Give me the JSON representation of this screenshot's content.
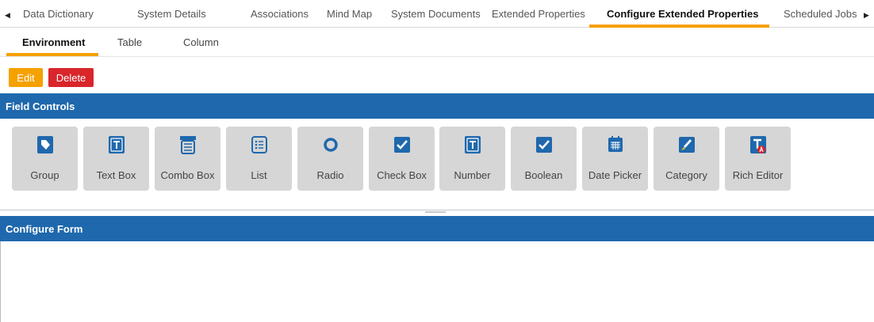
{
  "top_tabs": [
    {
      "label": "Data Dictionary",
      "active": false
    },
    {
      "label": "System Details",
      "active": false
    },
    {
      "label": "Associations",
      "active": false
    },
    {
      "label": "Mind Map",
      "active": false
    },
    {
      "label": "System Documents",
      "active": false
    },
    {
      "label": "Extended Properties",
      "active": false
    },
    {
      "label": "Configure Extended Properties",
      "active": true
    },
    {
      "label": "Scheduled Jobs",
      "active": false
    }
  ],
  "sub_tabs": [
    {
      "label": "Environment",
      "active": true
    },
    {
      "label": "Table",
      "active": false
    },
    {
      "label": "Column",
      "active": false
    }
  ],
  "actions": {
    "edit_label": "Edit",
    "delete_label": "Delete"
  },
  "sections": {
    "field_controls": "Field Controls",
    "configure_form": "Configure Form"
  },
  "controls": [
    {
      "label": "Group",
      "icon": "tag-icon"
    },
    {
      "label": "Text Box",
      "icon": "text-box-icon"
    },
    {
      "label": "Combo Box",
      "icon": "combo-box-icon"
    },
    {
      "label": "List",
      "icon": "list-icon"
    },
    {
      "label": "Radio",
      "icon": "radio-icon"
    },
    {
      "label": "Check Box",
      "icon": "checkbox-icon"
    },
    {
      "label": "Number",
      "icon": "number-icon"
    },
    {
      "label": "Boolean",
      "icon": "boolean-icon"
    },
    {
      "label": "Date Picker",
      "icon": "calendar-icon"
    },
    {
      "label": "Category",
      "icon": "brush-icon"
    },
    {
      "label": "Rich Editor",
      "icon": "rich-editor-icon"
    }
  ],
  "colors": {
    "accent": "#f5a100",
    "header_blue": "#1f68ad",
    "delete_red": "#d8262b",
    "icon_blue": "#1f68ad",
    "tile_gray": "#d6d6d6"
  }
}
